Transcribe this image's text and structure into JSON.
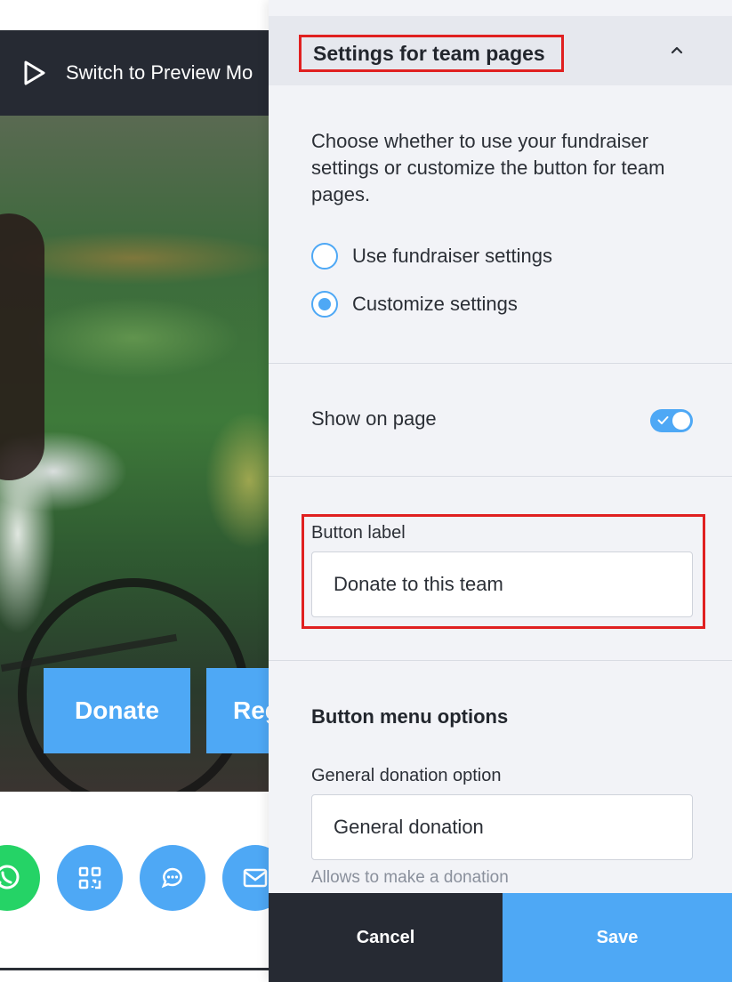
{
  "background": {
    "preview_label": "Switch to Preview Mo",
    "donate_label": "Donate",
    "register_label": "Reg",
    "share_icons": [
      "whatsapp-icon",
      "qr-code-icon",
      "chat-icon",
      "mail-icon"
    ]
  },
  "panel": {
    "header_title": "Settings for team pages",
    "description": "Choose whether to use your fundraiser settings or customize the button for team pages.",
    "radio_options": [
      {
        "label": "Use fundraiser settings",
        "selected": false
      },
      {
        "label": "Customize settings",
        "selected": true
      }
    ],
    "show_on_page": {
      "label": "Show on page",
      "enabled": true
    },
    "button_label": {
      "label": "Button label",
      "value": "Donate to this team"
    },
    "menu_options": {
      "title": "Button menu options",
      "general_label": "General donation option",
      "general_value": "General donation",
      "helper": "Allows to make a donation"
    },
    "footer": {
      "cancel": "Cancel",
      "save": "Save"
    }
  },
  "colors": {
    "accent": "#4ea8f5",
    "dark": "#262a33",
    "highlight": "#e02020",
    "whatsapp": "#25d366"
  }
}
